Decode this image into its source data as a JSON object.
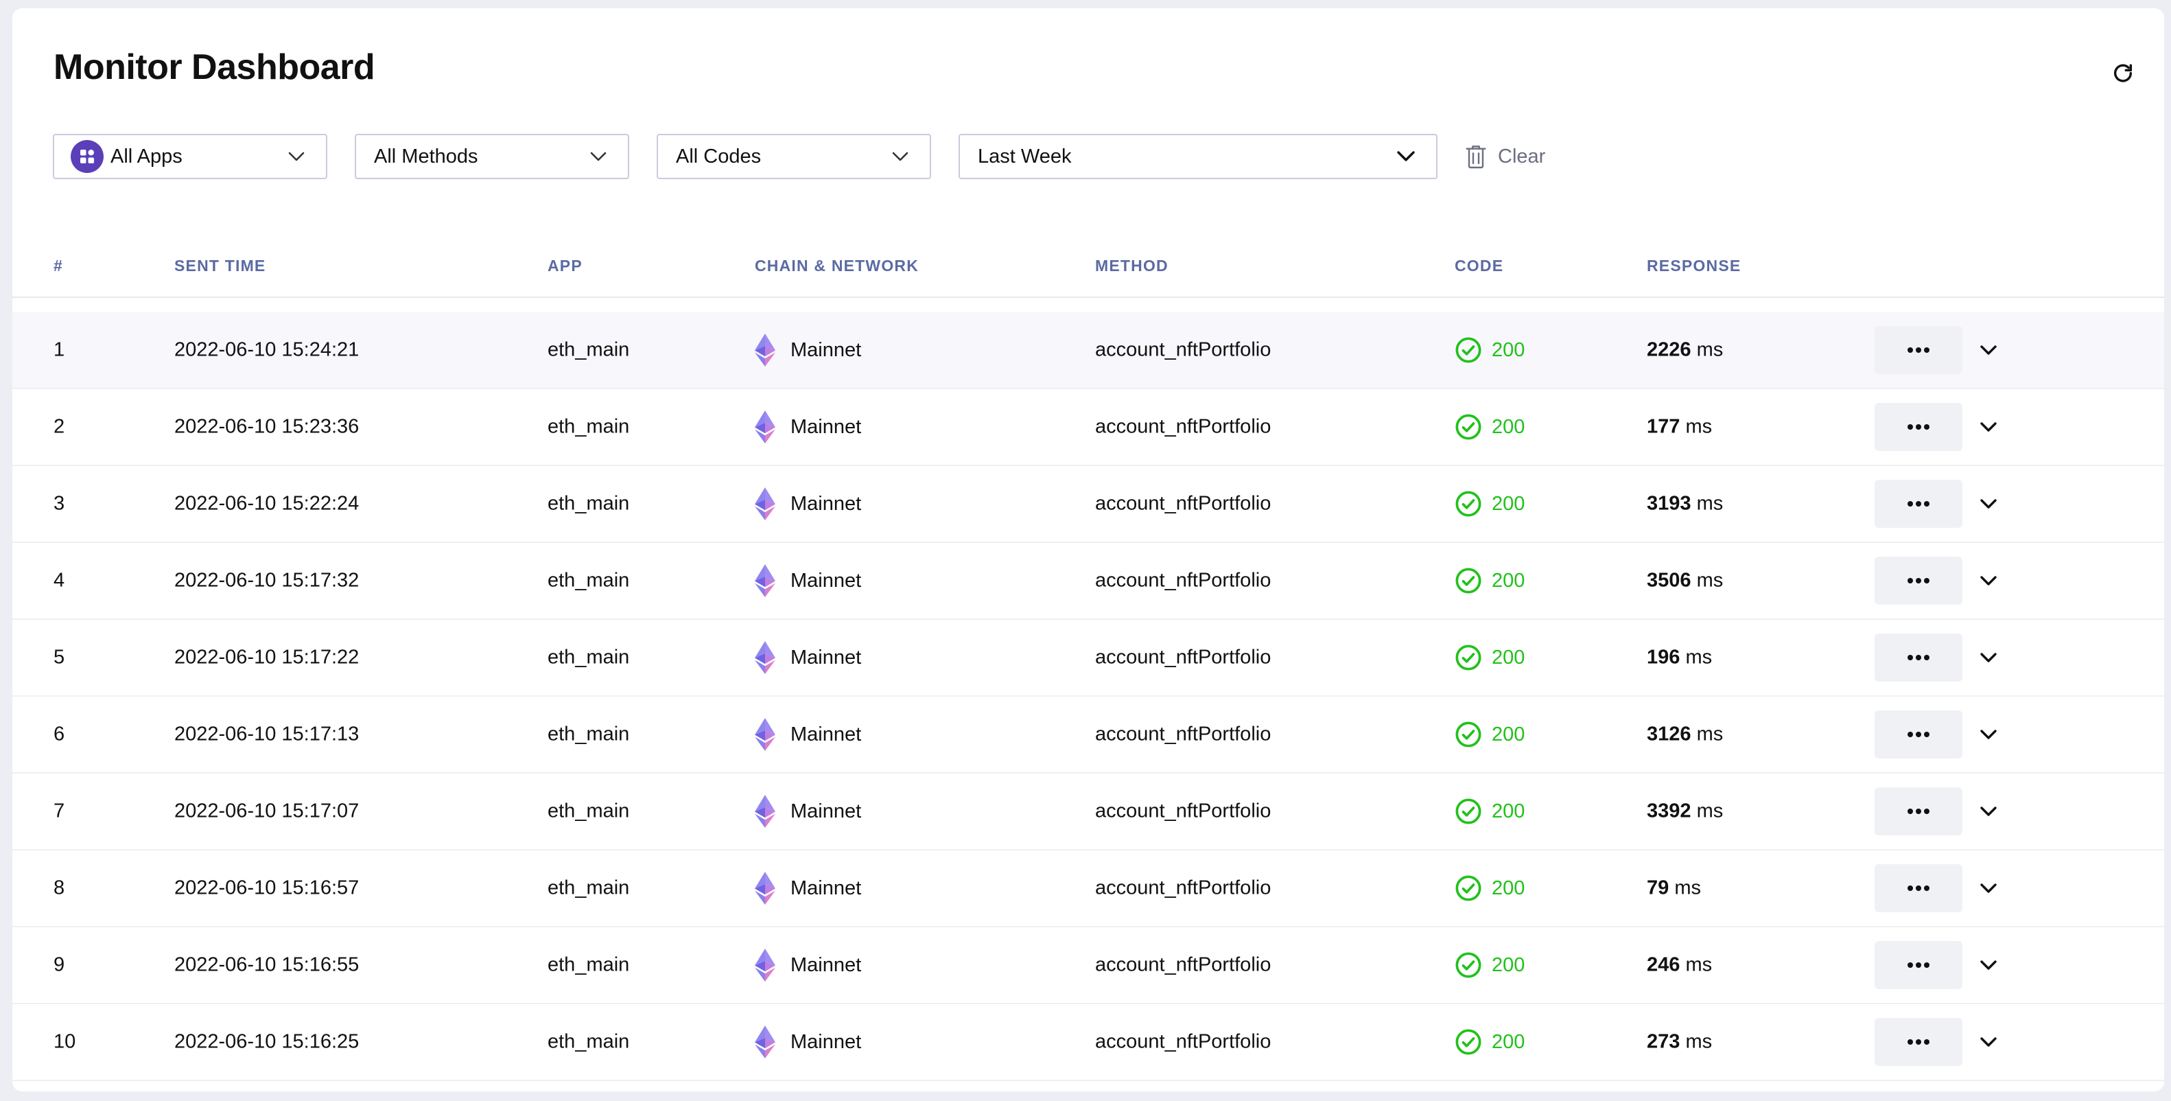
{
  "header": {
    "title": "Monitor Dashboard"
  },
  "filters": {
    "apps": "All Apps",
    "methods": "All Methods",
    "codes": "All Codes",
    "period": "Last Week",
    "clear": "Clear"
  },
  "table": {
    "columns": [
      "#",
      "SENT TIME",
      "APP",
      "CHAIN & NETWORK",
      "METHOD",
      "CODE",
      "RESPONSE"
    ],
    "unit": "ms",
    "rows": [
      {
        "idx": "1",
        "time": "2022-06-10 15:24:21",
        "app": "eth_main",
        "network": "Mainnet",
        "method": "account_nftPortfolio",
        "code": "200",
        "response": "2226"
      },
      {
        "idx": "2",
        "time": "2022-06-10 15:23:36",
        "app": "eth_main",
        "network": "Mainnet",
        "method": "account_nftPortfolio",
        "code": "200",
        "response": "177"
      },
      {
        "idx": "3",
        "time": "2022-06-10 15:22:24",
        "app": "eth_main",
        "network": "Mainnet",
        "method": "account_nftPortfolio",
        "code": "200",
        "response": "3193"
      },
      {
        "idx": "4",
        "time": "2022-06-10 15:17:32",
        "app": "eth_main",
        "network": "Mainnet",
        "method": "account_nftPortfolio",
        "code": "200",
        "response": "3506"
      },
      {
        "idx": "5",
        "time": "2022-06-10 15:17:22",
        "app": "eth_main",
        "network": "Mainnet",
        "method": "account_nftPortfolio",
        "code": "200",
        "response": "196"
      },
      {
        "idx": "6",
        "time": "2022-06-10 15:17:13",
        "app": "eth_main",
        "network": "Mainnet",
        "method": "account_nftPortfolio",
        "code": "200",
        "response": "3126"
      },
      {
        "idx": "7",
        "time": "2022-06-10 15:17:07",
        "app": "eth_main",
        "network": "Mainnet",
        "method": "account_nftPortfolio",
        "code": "200",
        "response": "3392"
      },
      {
        "idx": "8",
        "time": "2022-06-10 15:16:57",
        "app": "eth_main",
        "network": "Mainnet",
        "method": "account_nftPortfolio",
        "code": "200",
        "response": "79"
      },
      {
        "idx": "9",
        "time": "2022-06-10 15:16:55",
        "app": "eth_main",
        "network": "Mainnet",
        "method": "account_nftPortfolio",
        "code": "200",
        "response": "246"
      },
      {
        "idx": "10",
        "time": "2022-06-10 15:16:25",
        "app": "eth_main",
        "network": "Mainnet",
        "method": "account_nftPortfolio",
        "code": "200",
        "response": "273"
      }
    ]
  },
  "icons": {
    "refresh": "refresh-icon",
    "apps": "apps-grid-icon",
    "dropdown": "chevron-down-icon",
    "clear": "trash-icon",
    "chain": "ethereum-icon",
    "status_ok": "check-circle-icon",
    "more": "more-horizontal-icon",
    "expand": "chevron-down-icon"
  },
  "colors": {
    "accent": "#5b3fb8",
    "success": "#21c11b",
    "header_text": "#5b6aa3"
  }
}
